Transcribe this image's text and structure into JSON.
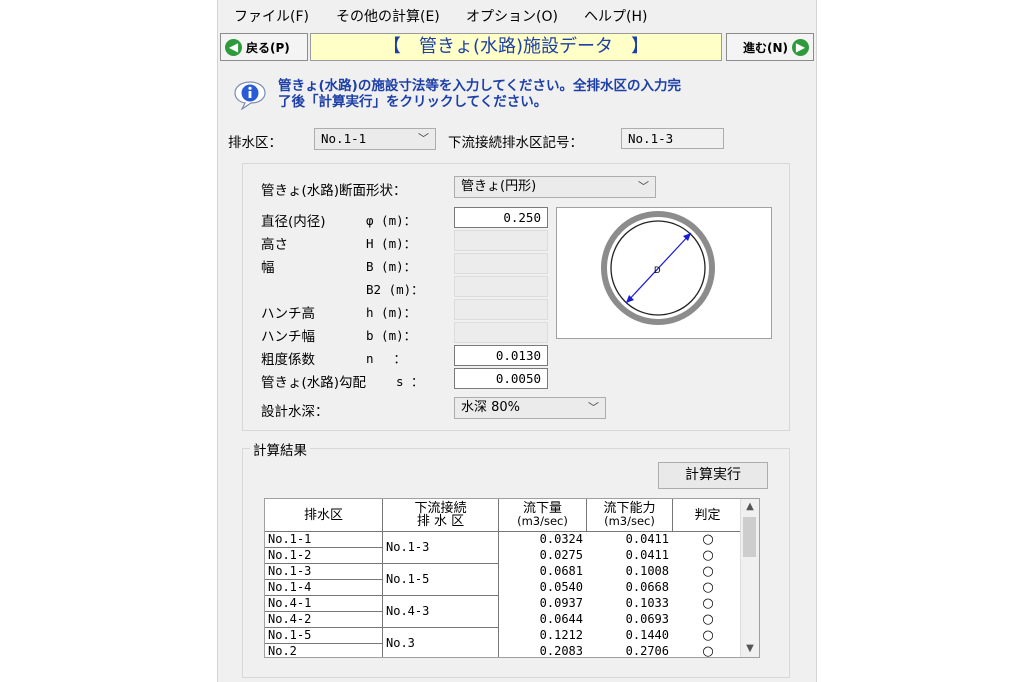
{
  "menu": {
    "file": "ファイル(F)",
    "other_calc": "その他の計算(E)",
    "options": "オプション(O)",
    "help": "ヘルプ(H)"
  },
  "nav": {
    "back_label": "戻る(P)",
    "next_label": "進む(N)",
    "title": "【　管きょ(水路)施設データ　】"
  },
  "info": {
    "line1": "管きょ(水路)の施設寸法等を入力してください。全排水区の入力完",
    "line2": "了後「計算実行」をクリックしてください。"
  },
  "district": {
    "label": "排水区：",
    "selected": "No.1-1",
    "downstream_label": "下流接続排水区記号：",
    "downstream_value": "No.1-3"
  },
  "section": {
    "shape_label": "管きょ(水路)断面形状：",
    "shape_value": "管きょ(円形)",
    "fields": [
      {
        "name": "直径(内径)",
        "symbol": "φ (m)：",
        "value": "0.250",
        "enabled": true
      },
      {
        "name": "高さ",
        "symbol": "H (m)：",
        "value": "",
        "enabled": false
      },
      {
        "name": "幅",
        "symbol": "B (m)：",
        "value": "",
        "enabled": false
      },
      {
        "name": "",
        "symbol": "B2 (m)：",
        "value": "",
        "enabled": false
      },
      {
        "name": "ハンチ高",
        "symbol": "h (m)：",
        "value": "",
        "enabled": false
      },
      {
        "name": "ハンチ幅",
        "symbol": "b (m)：",
        "value": "",
        "enabled": false
      },
      {
        "name": "粗度係数",
        "symbol": "n　 ：",
        "value": "0.0130",
        "enabled": true
      },
      {
        "name": "管きょ(水路)勾配",
        "symbol": "s ：",
        "value": "0.0050",
        "enabled": true
      }
    ],
    "depth_label": "設計水深：",
    "depth_value": "水深 80%",
    "diagram_label": "D"
  },
  "results": {
    "group_label": "計算結果",
    "calc_button": "計算実行",
    "headers": {
      "district": "排水区",
      "downstream_1": "下流接続",
      "downstream_2": "排 水 区",
      "flow_1": "流下量",
      "flow_2": "(m3/sec)",
      "capacity_1": "流下能力",
      "capacity_2": "(m3/sec)",
      "judge": "判定"
    },
    "rows": [
      {
        "district": "No.1-1",
        "flow": "0.0324",
        "capacity": "0.0411",
        "judge": "○"
      },
      {
        "district": "No.1-2",
        "flow": "0.0275",
        "capacity": "0.0411",
        "judge": "○"
      },
      {
        "district": "No.1-3",
        "flow": "0.0681",
        "capacity": "0.1008",
        "judge": "○"
      },
      {
        "district": "No.1-4",
        "flow": "0.0540",
        "capacity": "0.0668",
        "judge": "○"
      },
      {
        "district": "No.4-1",
        "flow": "0.0937",
        "capacity": "0.1033",
        "judge": "○"
      },
      {
        "district": "No.4-2",
        "flow": "0.0644",
        "capacity": "0.0693",
        "judge": "○"
      },
      {
        "district": "No.1-5",
        "flow": "0.1212",
        "capacity": "0.1440",
        "judge": "○"
      },
      {
        "district": "No.2",
        "flow": "0.2083",
        "capacity": "0.2706",
        "judge": "○"
      }
    ],
    "downstream_groups": [
      "No.1-3",
      "No.1-5",
      "No.4-3",
      "No.3"
    ]
  },
  "colors": {
    "title_text": "#1d3fa8",
    "title_bg": "#ffffc8",
    "nav_arrow": "#2f9a3c",
    "info_text": "#1d3fa8",
    "diagram_line": "#1a1ad8"
  }
}
